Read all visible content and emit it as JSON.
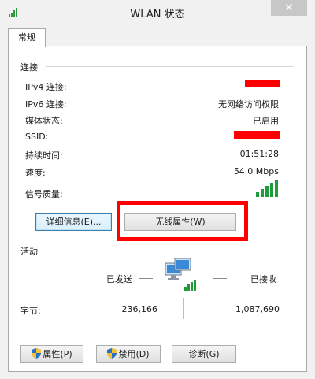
{
  "window": {
    "title": "WLAN 状态",
    "close_glyph": "✕"
  },
  "tabs": [
    {
      "label": "常规"
    }
  ],
  "connection": {
    "section_label": "连接",
    "rows": [
      {
        "label": "IPv4 连接:",
        "value": ""
      },
      {
        "label": "IPv6 连接:",
        "value": "无网络访问权限"
      },
      {
        "label": "媒体状态:",
        "value": "已启用"
      },
      {
        "label": "SSID:",
        "value": ""
      },
      {
        "label": "持续时间:",
        "value": "01:51:28"
      },
      {
        "label": "速度:",
        "value": "54.0 Mbps"
      }
    ],
    "signal_label": "信号质量:",
    "signal_level": 1.0,
    "details_button": "详细信息(E)...",
    "wireless_props_button": "无线属性(W)"
  },
  "activity": {
    "section_label": "活动",
    "sent_label": "已发送",
    "received_label": "已接收",
    "bytes_label": "字节:",
    "bytes_sent": "236,166",
    "bytes_received": "1,087,690"
  },
  "buttons": {
    "properties": "属性(P)",
    "disable": "禁用(D)",
    "diagnose": "诊断(G)"
  },
  "colors": {
    "accent": "#2b79c2",
    "highlight": "#ff0000",
    "signal": "#1e9c3b"
  }
}
